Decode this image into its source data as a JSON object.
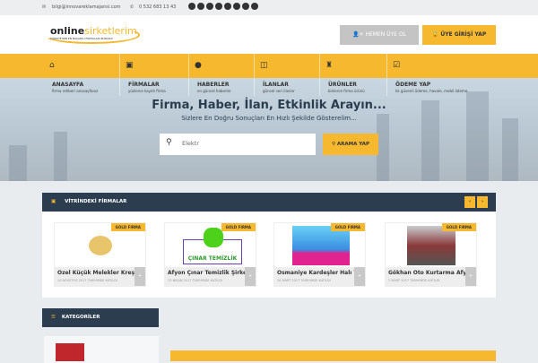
{
  "topbar": {
    "email": "bilgi@innovareklamajansi.com",
    "phone": "0 532 683 13 43",
    "social": [
      "facebook-icon",
      "twitter-icon",
      "google-plus-icon",
      "youtube-icon",
      "instagram-icon",
      "linkedin-icon",
      "vimeo-icon",
      "rss-icon"
    ]
  },
  "header": {
    "logo_main": "online",
    "logo_accent": "sirketlerim",
    "logo_tagline": "TÜRKİYE'NİN EN BAŞARILI FİRMALARI BURADA!",
    "register": "HEMEN ÜYE OL",
    "login": "ÜYE GİRİŞİ YAP"
  },
  "nav": [
    {
      "icon": "home-icon",
      "glyph": "⌂",
      "label": "ANASAYFA",
      "sub": "firma rehberi anasayfanız"
    },
    {
      "icon": "briefcase-icon",
      "glyph": "▣",
      "label": "FİRMALAR",
      "sub": "yüzlerce kayıtlı firma"
    },
    {
      "icon": "globe-icon",
      "glyph": "●",
      "label": "HABERLER",
      "sub": "en güncel haberler"
    },
    {
      "icon": "columns-icon",
      "glyph": "◫",
      "label": "İLANLAR",
      "sub": "güncel seri ilanlar"
    },
    {
      "icon": "gift-icon",
      "glyph": "♜",
      "label": "ÜRÜNLER",
      "sub": "binlerce firma ürünü"
    },
    {
      "icon": "check-square-icon",
      "glyph": "☑",
      "label": "ÖDEME YAP",
      "sub": "kk güvenli ödeme, havale, mobil ödeme"
    }
  ],
  "hero": {
    "title": "Firma, Haber, İlan, Etkinlik Arayın...",
    "subtitle": "Sizlere En Doğru Sonuçları En Hızlı Şekilde Gösterelim...",
    "search_value": "Elektr",
    "search_button": "ARAMA YAP"
  },
  "showcase": {
    "title": "VİTRİNDEKİ FİRMALAR",
    "badge": "GOLD FIRMA",
    "cards": [
      {
        "name": "Ozel Küçük Melekler Kreş",
        "date": "10 AĞUSTOS 2017 TARİHİNDE KATILDI"
      },
      {
        "name": "Afyon Çınar Temizlik Şirketi",
        "date": "13 NİSAN 2017 TARİHİNDE KATILDI",
        "logo_text": "ÇINAR TEMİZLİK"
      },
      {
        "name": "Osmaniye Kardeşler Halı Yıkama",
        "date": "16 MART 2017 TARİHİNDE KATILDI"
      },
      {
        "name": "Gökhan Oto Kurtarma Afyon",
        "date": "2 MART 2017 TARİHİNDE KATILDI"
      }
    ]
  },
  "categories": {
    "title": "KATEGORİLER"
  },
  "colors": {
    "accent": "#f5b82e",
    "dark": "#2b3d4f"
  }
}
